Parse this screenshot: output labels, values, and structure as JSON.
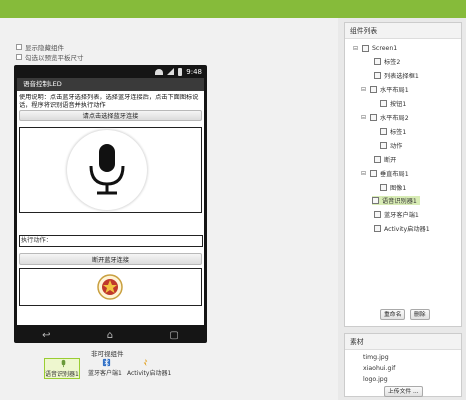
{
  "options": {
    "show_hidden": "显示隐藏组件",
    "tablet_preview": "勾选以预览平板尺寸"
  },
  "status_bar": {
    "time": "9:48"
  },
  "app": {
    "title": "语音控制LED",
    "description": "使用说明：点击蓝牙选择列表，选择蓝牙连接后，点击下面图标说话，程序将识别语音并执行动作",
    "connect_button": "请点击选择蓝牙连接",
    "action_label": "执行动作：",
    "disconnect_button": "断开蓝牙连接"
  },
  "nav_icons": [
    "back-icon",
    "home-icon",
    "recent-apps-icon"
  ],
  "nonvisible": {
    "heading": "非可视组件",
    "items": [
      {
        "label": "语音识别器1",
        "icon": "speech-recognizer-icon"
      },
      {
        "label": "蓝牙客户端1",
        "icon": "bluetooth-icon"
      },
      {
        "label": "Activity启动器1",
        "icon": "activity-starter-icon"
      }
    ]
  },
  "components": {
    "heading": "组件列表",
    "tree": [
      {
        "label": "Screen1"
      },
      {
        "label": "标签2"
      },
      {
        "label": "列表选择框1"
      },
      {
        "label": "水平布局1"
      },
      {
        "label": "按钮1"
      },
      {
        "label": "水平布局2"
      },
      {
        "label": "标签1"
      },
      {
        "label": "动作"
      },
      {
        "label": "断开"
      },
      {
        "label": "垂直布局1"
      },
      {
        "label": "图像1"
      },
      {
        "label": "语音识别器1"
      },
      {
        "label": "蓝牙客户端1"
      },
      {
        "label": "Activity启动器1"
      }
    ],
    "rename_button": "重命名",
    "delete_button": "删除"
  },
  "media": {
    "heading": "素材",
    "files": [
      "timg.jpg",
      "xiaohui.gif",
      "logo.jpg"
    ],
    "upload_button": "上传文件 ..."
  },
  "colors": {
    "topbar": "#86bb3a",
    "selection": "#d8ecb5",
    "title_bar": "#3a3a3a"
  }
}
